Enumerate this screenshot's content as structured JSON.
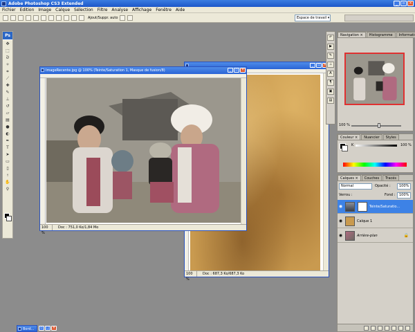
{
  "app": {
    "title": "Adobe Photoshop CS3 Extended",
    "logo": "Ps"
  },
  "menu": [
    "Fichier",
    "Edition",
    "Image",
    "Calque",
    "Sélection",
    "Filtre",
    "Analyse",
    "Affichage",
    "Fenêtre",
    "Aide"
  ],
  "options_bar": {
    "auto_select_label": "Ajout/Suppr. auto",
    "workspace_label": "Espace de travail ▾"
  },
  "doc_photo": {
    "title": "ImageRecente.jpg @ 100% (Teinte/Saturation 1, Masque de fusion/8)",
    "zoom": "100 %",
    "info": "Doc : 751,0 Ko/1,84 Mo"
  },
  "doc_texture": {
    "zoom": "100 %",
    "info": "Doc : 687,3 Ko/687,3 Ko"
  },
  "nav_panel": {
    "tabs": [
      "Navigation ×",
      "Histogramme",
      "Informations"
    ],
    "zoom": "100 %"
  },
  "color_panel": {
    "tabs": [
      "Couleur ×",
      "Nuancier",
      "Styles"
    ],
    "channel": "K",
    "value": "100",
    "unit": "%"
  },
  "layers_panel": {
    "tabs": [
      "Calques ×",
      "Couches",
      "Tracés"
    ],
    "blend_mode": "Normal",
    "opacity_label": "Opacité :",
    "opacity": "100%",
    "lock_label": "Verrou :",
    "fill_label": "Fond :",
    "fill": "100%",
    "layers": [
      {
        "name": "Teinte/Saturatio...",
        "selected": true
      },
      {
        "name": "Calque 1",
        "selected": false
      },
      {
        "name": "Arrière-plan",
        "selected": false
      }
    ]
  },
  "minimized": {
    "label": "Bord..."
  },
  "colors": {
    "accent": "#3d82e6",
    "titlebar": "#2a64d6",
    "panel": "#d4d0c8",
    "workspace": "#8c8c8c"
  }
}
